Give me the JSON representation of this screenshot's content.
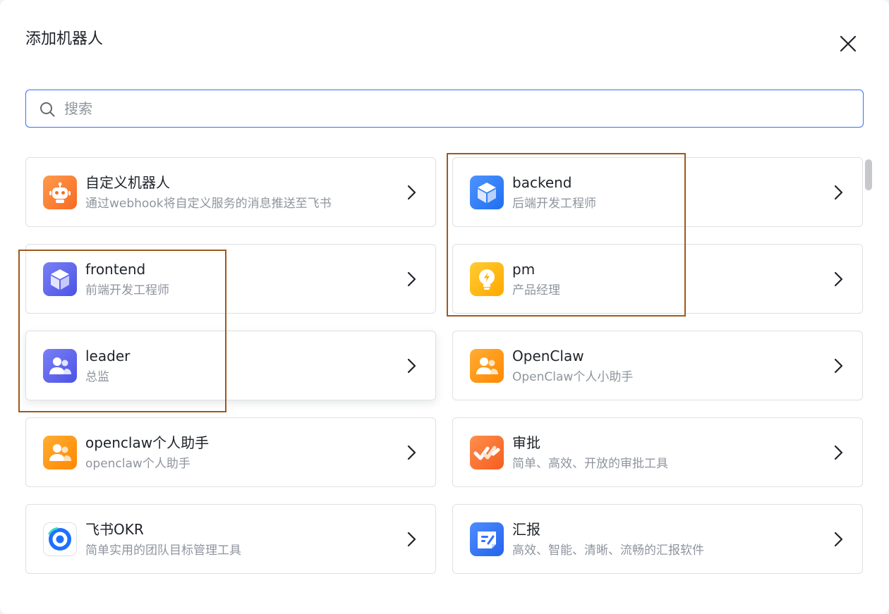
{
  "dialog": {
    "title": "添加机器人"
  },
  "search": {
    "placeholder": "搜索"
  },
  "bots": [
    {
      "name": "自定义机器人",
      "desc": "通过webhook将自定义服务的消息推送至飞书",
      "icon": "robot-icon",
      "color": "#ff7d34"
    },
    {
      "name": "backend",
      "desc": "后端开发工程师",
      "icon": "cube-icon",
      "color": "#2f7bf5"
    },
    {
      "name": "frontend",
      "desc": "前端开发工程师",
      "icon": "cube-icon",
      "color": "#5b64f0"
    },
    {
      "name": "pm",
      "desc": "产品经理",
      "icon": "lightbulb-icon",
      "color": "#ffba17"
    },
    {
      "name": "leader",
      "desc": "总监",
      "icon": "people-icon",
      "color": "#5b64f0"
    },
    {
      "name": "OpenClaw",
      "desc": "OpenClaw个人小助手",
      "icon": "people-icon",
      "color": "#ff9317"
    },
    {
      "name": "openclaw个人助手",
      "desc": "openclaw个人助手",
      "icon": "people-icon",
      "color": "#ff9317"
    },
    {
      "name": "审批",
      "desc": "简单、高效、开放的审批工具",
      "icon": "approval-icon",
      "color": "#ff7d34"
    },
    {
      "name": "飞书OKR",
      "desc": "简单实用的团队目标管理工具",
      "icon": "okr-target-icon",
      "color": "#1e6fff"
    },
    {
      "name": "汇报",
      "desc": "高效、智能、清晰、流畅的汇报软件",
      "icon": "report-icon",
      "color": "#3370ff"
    }
  ],
  "colors": {
    "accent": "#3370ff",
    "highlight": "#a0581a",
    "text_primary": "#1f2329",
    "text_secondary": "#8f959e"
  }
}
